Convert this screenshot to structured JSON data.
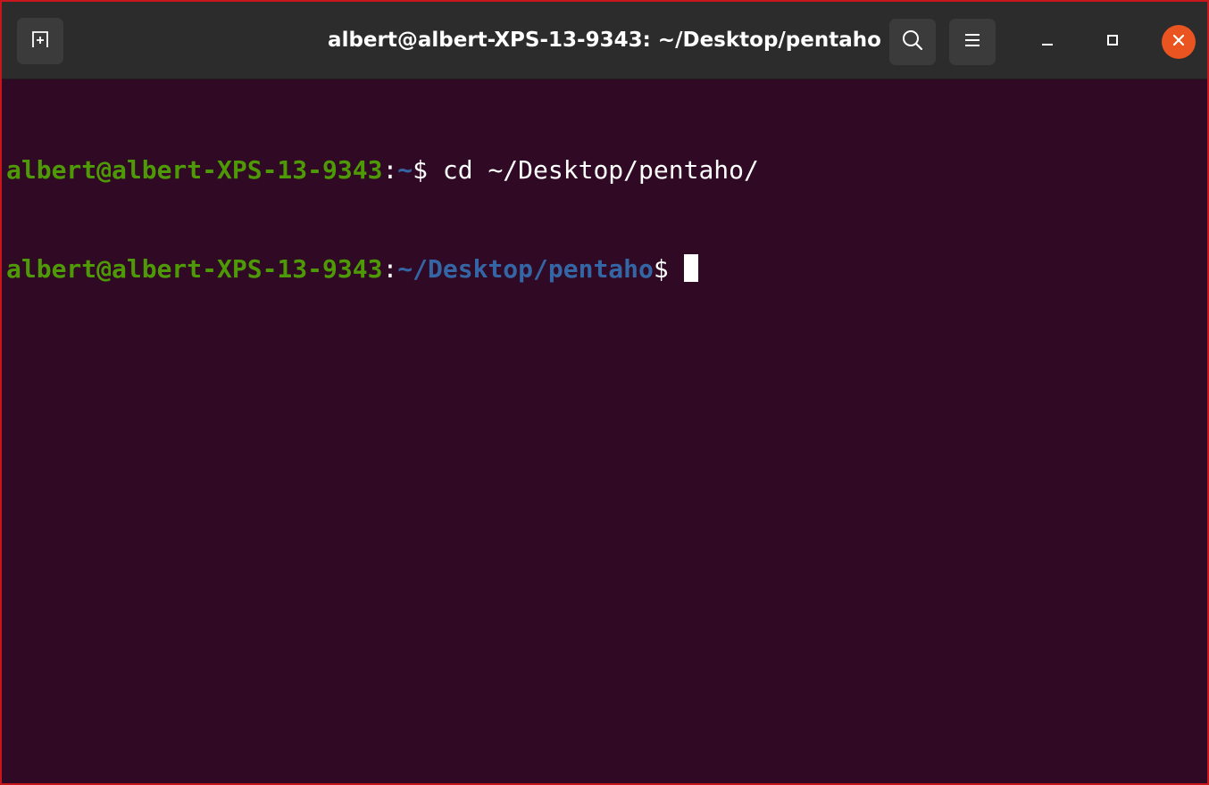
{
  "window": {
    "title": "albert@albert-XPS-13-9343: ~/Desktop/pentaho"
  },
  "titlebar": {
    "new_tab_icon": "new-tab-icon",
    "search_icon": "search-icon",
    "menu_icon": "hamburger-menu-icon",
    "minimize_icon": "minimize-icon",
    "maximize_icon": "maximize-icon",
    "close_icon": "close-icon"
  },
  "terminal": {
    "lines": [
      {
        "user_host": "albert@albert-XPS-13-9343",
        "sep": ":",
        "path": "~",
        "prompt": "$",
        "command": " cd ~/Desktop/pentaho/"
      },
      {
        "user_host": "albert@albert-XPS-13-9343",
        "sep": ":",
        "path": "~/Desktop/pentaho",
        "prompt": "$",
        "command": " "
      }
    ]
  },
  "colors": {
    "background": "#300a24",
    "titlebar": "#2c2c2c",
    "user_host": "#4e9a06",
    "path": "#3465a4",
    "text": "#ffffff",
    "close_button": "#e95420",
    "outline": "#c8161d"
  }
}
